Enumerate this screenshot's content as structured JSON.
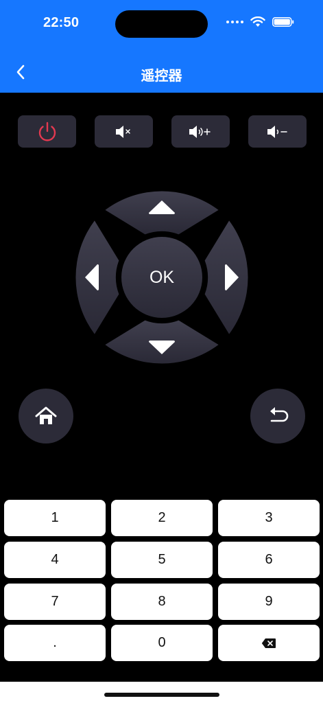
{
  "status_bar": {
    "time": "22:50"
  },
  "nav": {
    "title": "遥控器",
    "back_icon": "chevron-left-icon"
  },
  "controls": [
    {
      "name": "power-button",
      "icon": "power-icon",
      "color": "#e53950"
    },
    {
      "name": "mute-button",
      "icon": "speaker-mute-icon",
      "color": "#ffffff"
    },
    {
      "name": "volume-up-button",
      "icon": "speaker-plus-icon",
      "color": "#ffffff"
    },
    {
      "name": "volume-down-button",
      "icon": "speaker-minus-icon",
      "color": "#ffffff"
    }
  ],
  "dpad": {
    "ok_label": "OK"
  },
  "keys": [
    "1",
    "2",
    "3",
    "4",
    "5",
    "6",
    "7",
    "8",
    "9",
    ".",
    "0"
  ],
  "colors": {
    "brand_blue": "#1677ff",
    "button_bg": "#2c2b38",
    "power_red": "#e53950"
  }
}
